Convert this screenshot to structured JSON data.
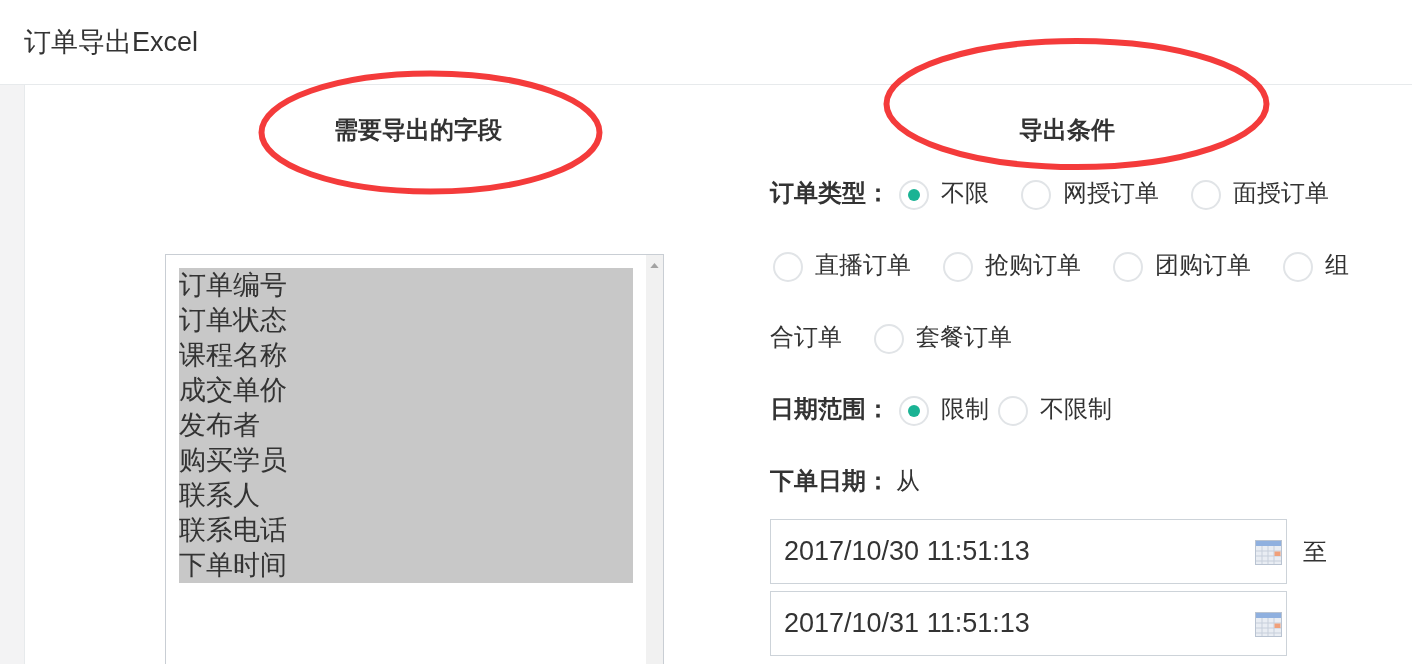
{
  "header": {
    "title": "订单导出Excel"
  },
  "fields_panel": {
    "title": "需要导出的字段",
    "circled": true,
    "fields": [
      {
        "label": "订单编号",
        "selected": true
      },
      {
        "label": "订单状态",
        "selected": true
      },
      {
        "label": "课程名称",
        "selected": true
      },
      {
        "label": "成交单价",
        "selected": true
      },
      {
        "label": "发布者",
        "selected": true
      },
      {
        "label": "购买学员",
        "selected": true
      },
      {
        "label": "联系人",
        "selected": true
      },
      {
        "label": "联系电话",
        "selected": true
      },
      {
        "label": "下单时间",
        "selected": true
      }
    ]
  },
  "conditions_panel": {
    "title": "导出条件",
    "circled": true,
    "order_type": {
      "label": "订单类型：",
      "options": [
        {
          "label": "不限",
          "selected": true
        },
        {
          "label": "网授订单",
          "selected": false
        },
        {
          "label": "面授订单",
          "selected": false
        },
        {
          "label": "直播订单",
          "selected": false
        },
        {
          "label": "抢购订单",
          "selected": false
        },
        {
          "label": "团购订单",
          "selected": false
        },
        {
          "label_lines": [
            "组",
            "合订单"
          ],
          "selected": false
        },
        {
          "label": "套餐订单",
          "selected": false
        }
      ]
    },
    "date_range": {
      "label": "日期范围：",
      "options": [
        {
          "label": "限制",
          "selected": true
        },
        {
          "label": "不限制",
          "selected": false
        }
      ]
    },
    "order_date": {
      "label": "下单日期：",
      "from_text": "从",
      "start": {
        "value": "2017/10/30 11:51:13"
      },
      "to_text": "至",
      "end": {
        "value": "2017/10/31 11:51:13"
      }
    }
  }
}
